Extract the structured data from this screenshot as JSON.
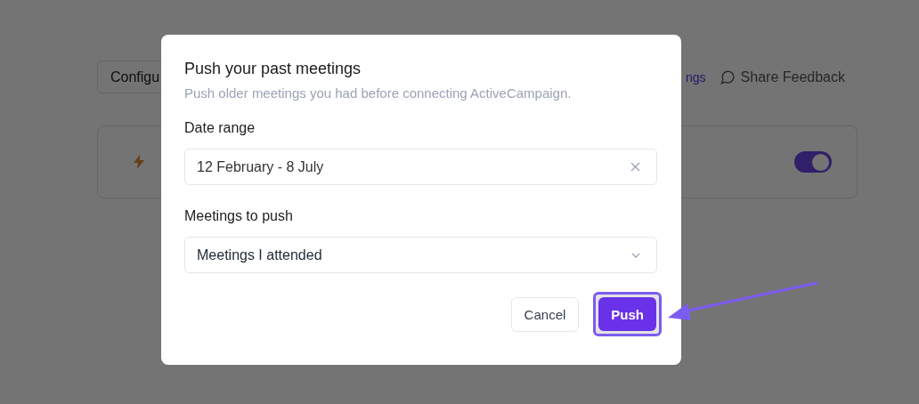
{
  "background": {
    "config_button": "Configu",
    "settings_link": "ngs",
    "feedback_link": "Share Feedback",
    "card": {
      "toggle": {
        "on": true
      }
    }
  },
  "dialog": {
    "title": "Push your past meetings",
    "subtitle": "Push older meetings you had before connecting ActiveCampaign.",
    "fields": [
      {
        "kind": "clearable",
        "label": "Date range",
        "value": "12 February - 8 July"
      },
      {
        "kind": "dropdown",
        "label": "Meetings to push",
        "value": "Meetings I attended"
      }
    ],
    "buttons": [
      {
        "label": "Cancel",
        "kind": "secondary",
        "highlighted": false
      },
      {
        "label": "Push",
        "kind": "primary",
        "highlighted": true
      }
    ]
  }
}
